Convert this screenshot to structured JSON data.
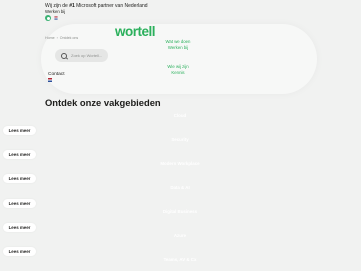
{
  "topbar": {
    "announcement_prefix": "Wij zijn de ",
    "announcement_bold": "#1",
    "announcement_suffix": " Microsoft partner van Nederland",
    "werken_bij": "Werken bij"
  },
  "brand": {
    "logo_text": "wortell",
    "accent_color": "#2bb05c"
  },
  "breadcrumb": {
    "home": "Home",
    "separator": "›",
    "current": "Ontdek ons"
  },
  "nav": {
    "item_1": [
      "Wat we doen",
      "Werken bij"
    ],
    "item_2": [
      "Wie wij zijn",
      "Kennis"
    ]
  },
  "search": {
    "placeholder": "Zoek op Wortell..."
  },
  "contact": {
    "label": "Contact"
  },
  "main": {
    "heading": "Ontdek onze vakgebieden",
    "areas": [
      "Cloud",
      "Security",
      "Modern Workplace",
      "Data & AI",
      "Digital Business",
      "Azure",
      "Teams, AV & Cx"
    ],
    "more_label": "Lees meer"
  }
}
